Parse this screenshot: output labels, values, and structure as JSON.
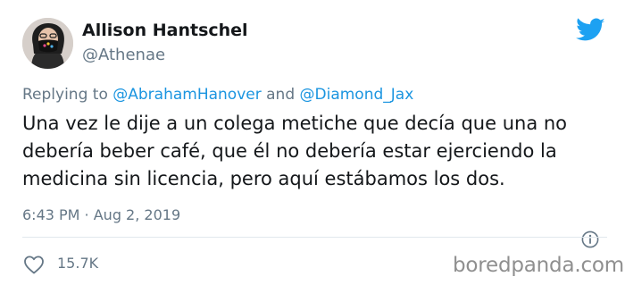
{
  "author": {
    "display_name": "Allison Hantschel",
    "handle": "@Athenae",
    "avatar_icon": "profile-photo"
  },
  "brand_icon": "twitter-bird-icon",
  "reply": {
    "prefix": "Replying to",
    "mention_1": "@AbrahamHanover",
    "conjunction": "and",
    "mention_2": "@Diamond_Jax"
  },
  "tweet_text": "Una vez le dije a un colega metiche que decía que una no debería beber café, que él no debería estar ejerciendo la medicina sin licencia, pero aquí estábamos los dos.",
  "timestamp": "6:43 PM · Aug 2, 2019",
  "info_icon": "info-icon",
  "likes": {
    "icon": "heart-icon",
    "count": "15.7K"
  },
  "watermark": "boredpanda.com",
  "colors": {
    "twitter_blue": "#1da1f2",
    "mention_blue": "#1b95e0",
    "secondary_text": "#657786",
    "primary_text": "#14171a",
    "divider": "#e1e8ed"
  }
}
